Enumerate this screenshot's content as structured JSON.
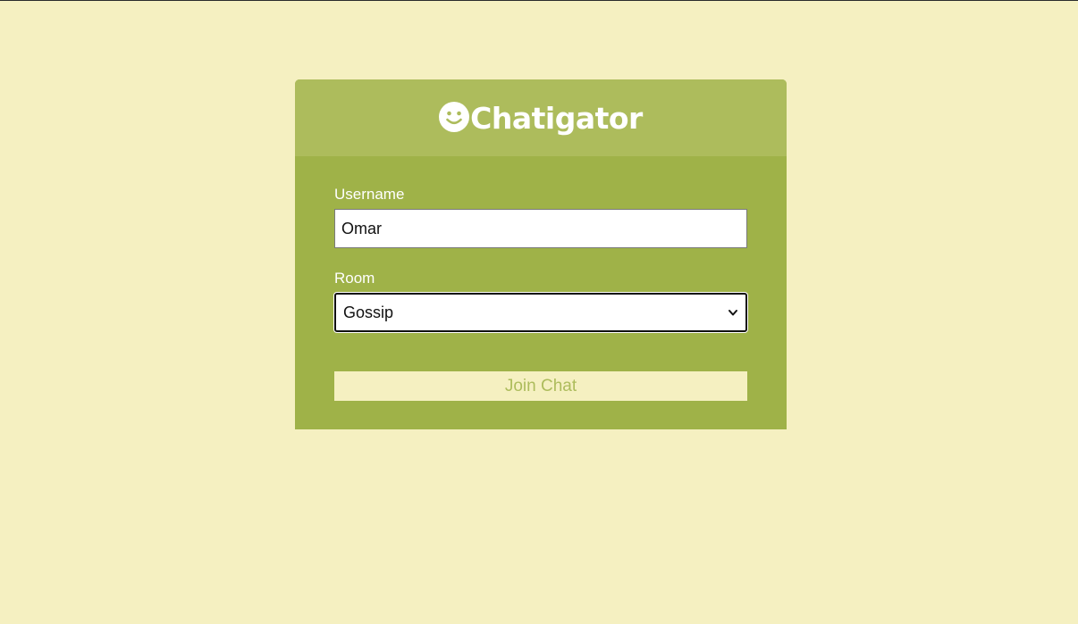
{
  "app": {
    "title": "Chatigator",
    "logo_icon": "smiley-icon"
  },
  "form": {
    "username_label": "Username",
    "username_value": "Omar",
    "room_label": "Room",
    "room_selected": "Gossip",
    "join_label": "Join Chat"
  },
  "colors": {
    "page_background": "#f5f0c1",
    "card_body": "#9fb248",
    "card_header": "#adbc5c",
    "button_text": "#adbc5c"
  }
}
